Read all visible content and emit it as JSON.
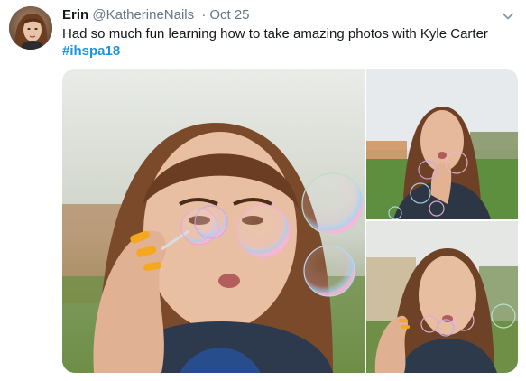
{
  "tweet": {
    "display_name": "Erin",
    "handle": "@KatherineNails",
    "separator": "·",
    "date": "Oct 25",
    "text": "Had so much fun learning how to take amazing photos with Kyle Carter",
    "hashtag": "#ihspa18"
  },
  "icons": {
    "menu": "chevron-down-icon"
  },
  "colors": {
    "text_primary": "#14171a",
    "text_secondary": "#657786",
    "link": "#1b95e0"
  }
}
